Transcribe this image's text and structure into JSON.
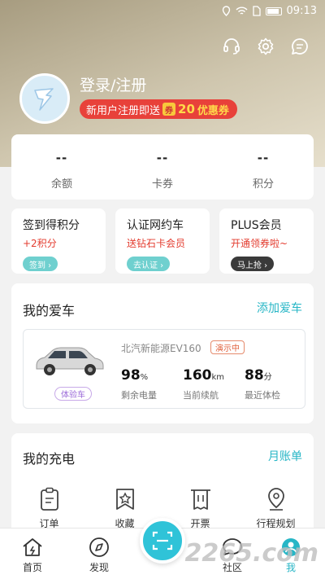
{
  "status_bar": {
    "time": "09:13"
  },
  "header": {
    "login_title": "登录/注册",
    "promo": {
      "prefix": "新用户注册即送",
      "amount": "20",
      "suffix": "优惠券"
    }
  },
  "stats": [
    {
      "value": "--",
      "label": "余额"
    },
    {
      "value": "--",
      "label": "卡券"
    },
    {
      "value": "--",
      "label": "积分"
    }
  ],
  "promo_cards": [
    {
      "title": "签到得积分",
      "subtitle": "+2积分",
      "button": "签到 ›",
      "button_color": "#6fd0cf"
    },
    {
      "title": "认证网约车",
      "subtitle": "送钻石卡会员",
      "button": "去认证 ›",
      "button_color": "#6fd0cf"
    },
    {
      "title": "PLUS会员",
      "subtitle": "开通领券啦~",
      "button": "马上抢 ›",
      "button_color": "#3a3a3a"
    }
  ],
  "my_car": {
    "title": "我的爱车",
    "add_link": "添加爱车",
    "car_name": "北汽新能源EV160",
    "demo_badge": "演示中",
    "trial_badge": "体验车",
    "metrics": [
      {
        "value": "98",
        "unit": "%",
        "label": "剩余电量"
      },
      {
        "value": "160",
        "unit": "km",
        "label": "当前续航"
      },
      {
        "value": "88",
        "unit": "分",
        "label": "最近体检"
      }
    ]
  },
  "my_charge": {
    "title": "我的充电",
    "bill_link": "月账单",
    "items": [
      {
        "icon": "clipboard-icon",
        "label": "订单"
      },
      {
        "icon": "star-icon",
        "label": "收藏"
      },
      {
        "icon": "invoice-icon",
        "label": "开票"
      },
      {
        "icon": "location-pin-icon",
        "label": "行程规划"
      }
    ]
  },
  "tabbar": {
    "items": [
      {
        "label": "首页",
        "icon": "home-icon"
      },
      {
        "label": "发现",
        "icon": "compass-icon"
      },
      {
        "label": "社区",
        "icon": "chat-icon"
      },
      {
        "label": "我",
        "icon": "profile-icon"
      }
    ]
  },
  "watermark": "2265.com",
  "colors": {
    "accent": "#27b6c6",
    "promo_red": "#e8413a",
    "scan_button": "#2fc3d8"
  }
}
